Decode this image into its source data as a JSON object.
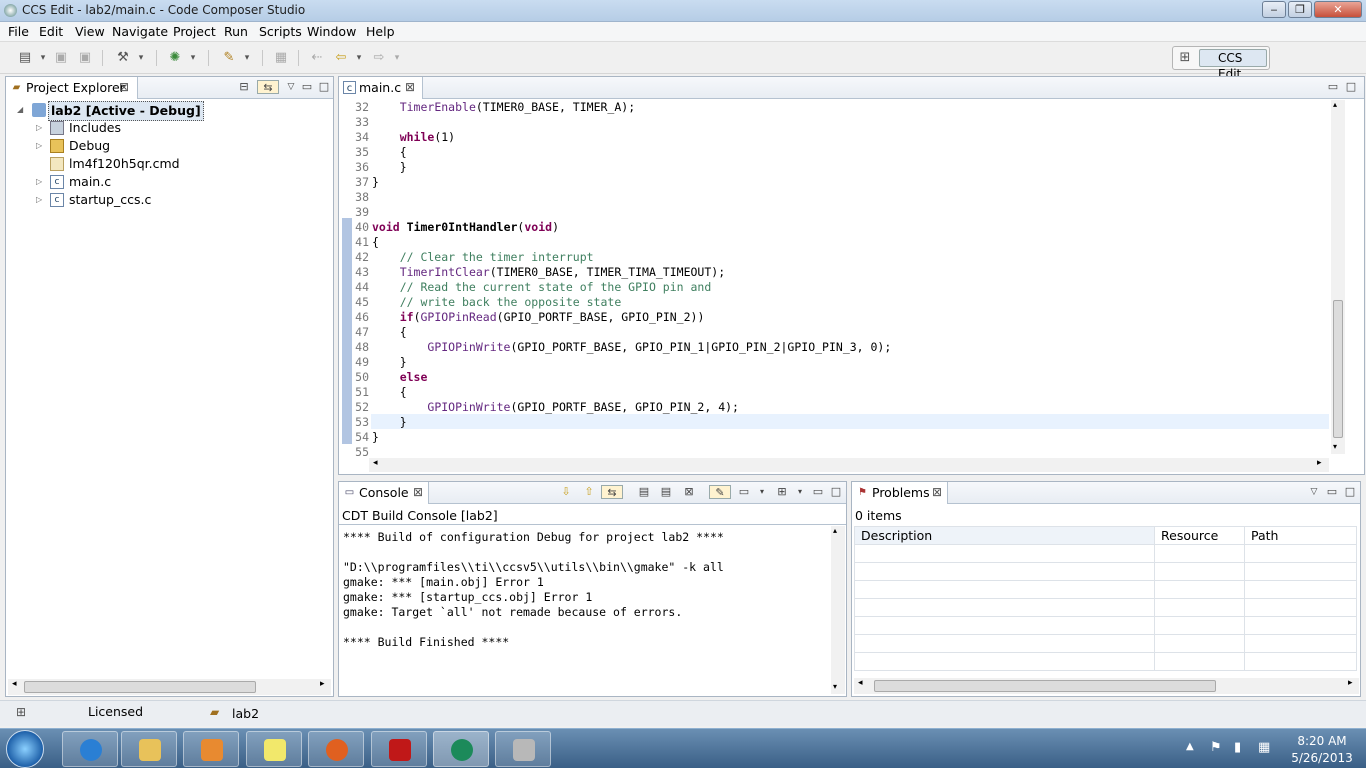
{
  "window": {
    "title": "CCS Edit - lab2/main.c - Code Composer Studio",
    "min": "‒",
    "max": "❐",
    "close": "✕"
  },
  "menu": [
    "File",
    "Edit",
    "View",
    "Navigate",
    "Project",
    "Run",
    "Scripts",
    "Window",
    "Help"
  ],
  "perspective": {
    "label": "CCS Edit"
  },
  "project_explorer": {
    "tab": "Project Explorer",
    "root": "lab2  [Active - Debug]",
    "items": [
      "Includes",
      "Debug",
      "lm4f120h5qr.cmd",
      "main.c",
      "startup_ccs.c"
    ]
  },
  "editor": {
    "tab": "main.c",
    "lines": [
      {
        "n": "32",
        "t": "    TimerEnable(TIMER0_BASE, TIMER_A);"
      },
      {
        "n": "33",
        "t": ""
      },
      {
        "n": "34",
        "t": "    while(1)"
      },
      {
        "n": "35",
        "t": "    {"
      },
      {
        "n": "36",
        "t": "    }"
      },
      {
        "n": "37",
        "t": "}"
      },
      {
        "n": "38",
        "t": ""
      },
      {
        "n": "39",
        "t": ""
      },
      {
        "n": "40",
        "t": "void Timer0IntHandler(void)"
      },
      {
        "n": "41",
        "t": "{"
      },
      {
        "n": "42",
        "t": "    // Clear the timer interrupt"
      },
      {
        "n": "43",
        "t": "    TimerIntClear(TIMER0_BASE, TIMER_TIMA_TIMEOUT);"
      },
      {
        "n": "44",
        "t": "    // Read the current state of the GPIO pin and"
      },
      {
        "n": "45",
        "t": "    // write back the opposite state"
      },
      {
        "n": "46",
        "t": "    if(GPIOPinRead(GPIO_PORTF_BASE, GPIO_PIN_2))"
      },
      {
        "n": "47",
        "t": "    {"
      },
      {
        "n": "48",
        "t": "        GPIOPinWrite(GPIO_PORTF_BASE, GPIO_PIN_1|GPIO_PIN_2|GPIO_PIN_3, 0);"
      },
      {
        "n": "49",
        "t": "    }"
      },
      {
        "n": "50",
        "t": "    else"
      },
      {
        "n": "51",
        "t": "    {"
      },
      {
        "n": "52",
        "t": "        GPIOPinWrite(GPIO_PORTF_BASE, GPIO_PIN_2, 4);"
      },
      {
        "n": "53",
        "t": "    }"
      },
      {
        "n": "54",
        "t": "}"
      },
      {
        "n": "55",
        "t": ""
      }
    ]
  },
  "console": {
    "tab": "Console",
    "header": "CDT Build Console [lab2]",
    "text": "**** Build of configuration Debug for project lab2 ****\n\n\"D:\\\\programfiles\\\\ti\\\\ccsv5\\\\utils\\\\bin\\\\gmake\" -k all\ngmake: *** [main.obj] Error 1\ngmake: *** [startup_ccs.obj] Error 1\ngmake: Target `all' not remade because of errors.\n\n**** Build Finished ****"
  },
  "problems": {
    "tab": "Problems",
    "count": "0 items",
    "columns": [
      "Description",
      "Resource",
      "Path"
    ]
  },
  "status": {
    "license": "Licensed",
    "project": "lab2"
  },
  "taskbar": {
    "time": "8:20 AM",
    "date": "5/26/2013"
  },
  "colors": {
    "keyword": "#7f0055",
    "comment": "#3f7f5f",
    "function": "#642880",
    "accent": "#dde7f2"
  }
}
